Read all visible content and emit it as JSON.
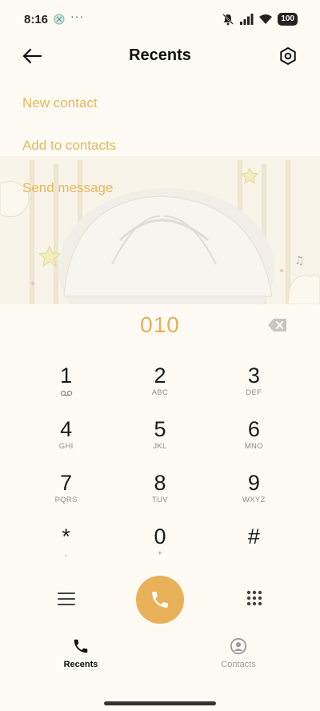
{
  "status_bar": {
    "time": "8:16",
    "dots": "···",
    "battery": "100"
  },
  "header": {
    "title": "Recents"
  },
  "actions": [
    {
      "label": "New contact"
    },
    {
      "label": "Add to contacts"
    },
    {
      "label": "Send message"
    }
  ],
  "dialer": {
    "number": "010"
  },
  "keypad": [
    {
      "digit": "1",
      "letters": ""
    },
    {
      "digit": "2",
      "letters": "ABC"
    },
    {
      "digit": "3",
      "letters": "DEF"
    },
    {
      "digit": "4",
      "letters": "GHI"
    },
    {
      "digit": "5",
      "letters": "JKL"
    },
    {
      "digit": "6",
      "letters": "MNO"
    },
    {
      "digit": "7",
      "letters": "PQRS"
    },
    {
      "digit": "8",
      "letters": "TUV"
    },
    {
      "digit": "9",
      "letters": "WXYZ"
    },
    {
      "digit": "*",
      "letters": ","
    },
    {
      "digit": "0",
      "letters": "+"
    },
    {
      "digit": "#",
      "letters": ""
    }
  ],
  "bottom_nav": {
    "recents": "Recents",
    "contacts": "Contacts"
  },
  "colors": {
    "accent": "#e8b75e",
    "call_button": "#e9b15a",
    "background": "#fdfbf3"
  },
  "icons": {
    "back": "arrow-left-icon",
    "settings": "hexagon-gear-icon",
    "backspace": "backspace-icon",
    "menu": "menu-icon",
    "call": "phone-icon",
    "dialpad": "dialpad-icon",
    "recents": "phone-icon",
    "contacts": "person-circle-icon"
  }
}
